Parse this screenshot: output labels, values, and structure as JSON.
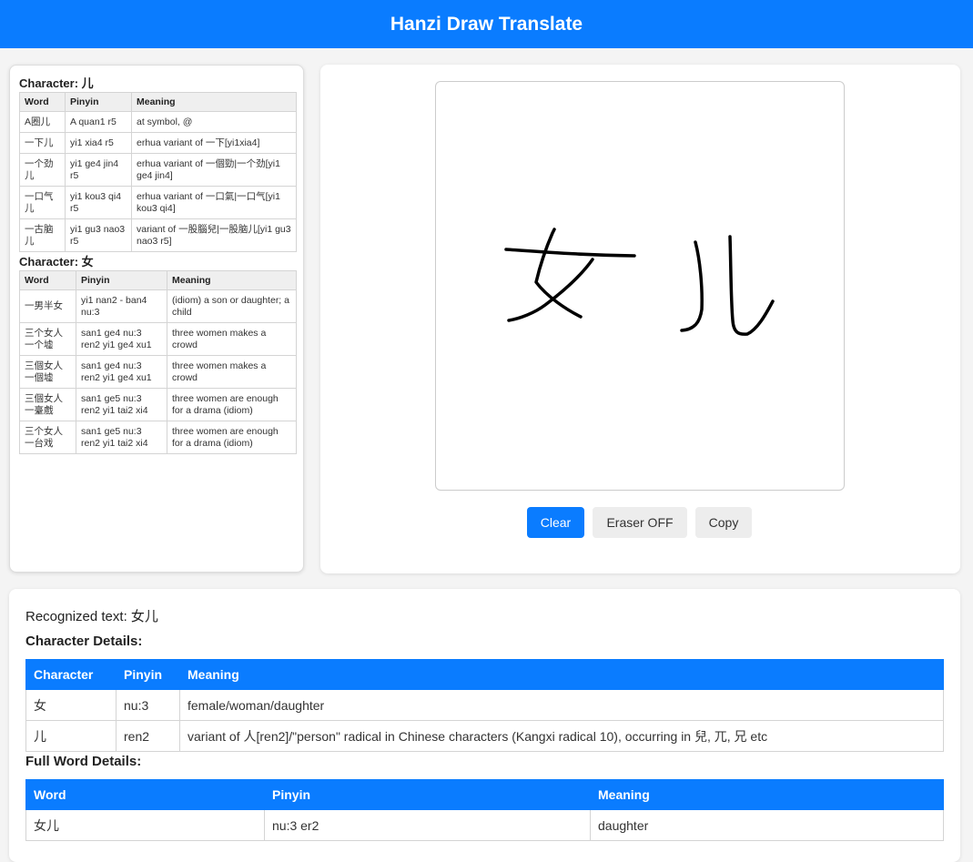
{
  "app": {
    "title": "Hanzi Draw Translate"
  },
  "side": {
    "sections": [
      {
        "title": "Character: 儿",
        "headers": [
          "Word",
          "Pinyin",
          "Meaning"
        ],
        "rows": [
          [
            "A圈儿",
            "A quan1 r5",
            "at symbol, @"
          ],
          [
            "一下儿",
            "yi1 xia4 r5",
            "erhua variant of 一下[yi1xia4]"
          ],
          [
            "一个劲儿",
            "yi1 ge4 jin4 r5",
            "erhua variant of 一個勁|一个劲[yi1 ge4 jin4]"
          ],
          [
            "一口气儿",
            "yi1 kou3 qi4 r5",
            "erhua variant of 一口氣|一口气[yi1 kou3 qi4]"
          ],
          [
            "一古脑儿",
            "yi1 gu3 nao3 r5",
            "variant of 一股腦兒|一股脑儿[yi1 gu3 nao3 r5]"
          ]
        ]
      },
      {
        "title": "Character: 女",
        "headers": [
          "Word",
          "Pinyin",
          "Meaning"
        ],
        "rows": [
          [
            "一男半女",
            "yi1 nan2 - ban4 nu:3",
            "(idiom) a son or daughter; a child"
          ],
          [
            "三个女人一个墟",
            "san1 ge4 nu:3 ren2 yi1 ge4 xu1",
            "three women makes a crowd"
          ],
          [
            "三個女人一個墟",
            "san1 ge4 nu:3 ren2 yi1 ge4 xu1",
            "three women makes a crowd"
          ],
          [
            "三個女人一臺戲",
            "san1 ge5 nu:3 ren2 yi1 tai2 xi4",
            "three women are enough for a drama (idiom)"
          ],
          [
            "三个女人一台戏",
            "san1 ge5 nu:3 ren2 yi1 tai2 xi4",
            "three women are enough for a drama (idiom)"
          ]
        ]
      }
    ]
  },
  "toolbar": {
    "clear_label": "Clear",
    "eraser_label": "Eraser OFF",
    "copy_label": "Copy"
  },
  "results": {
    "recognized": "Recognized text: 女儿",
    "char_details_title": "Character Details:",
    "char_headers": [
      "Character",
      "Pinyin",
      "Meaning"
    ],
    "char_rows": [
      [
        "女",
        "nu:3",
        "female/woman/daughter"
      ],
      [
        "儿",
        "ren2",
        "variant of 人[ren2]/\"person\" radical in Chinese characters (Kangxi radical 10), occurring in 兒, 兀, 兄 etc"
      ]
    ],
    "word_details_title": "Full Word Details:",
    "word_headers": [
      "Word",
      "Pinyin",
      "Meaning"
    ],
    "word_rows": [
      [
        "女儿",
        "nu:3 er2",
        "daughter"
      ]
    ]
  },
  "colors": {
    "accent": "#0a7cff",
    "button_secondary": "#ededed",
    "stroke": "#000000"
  }
}
